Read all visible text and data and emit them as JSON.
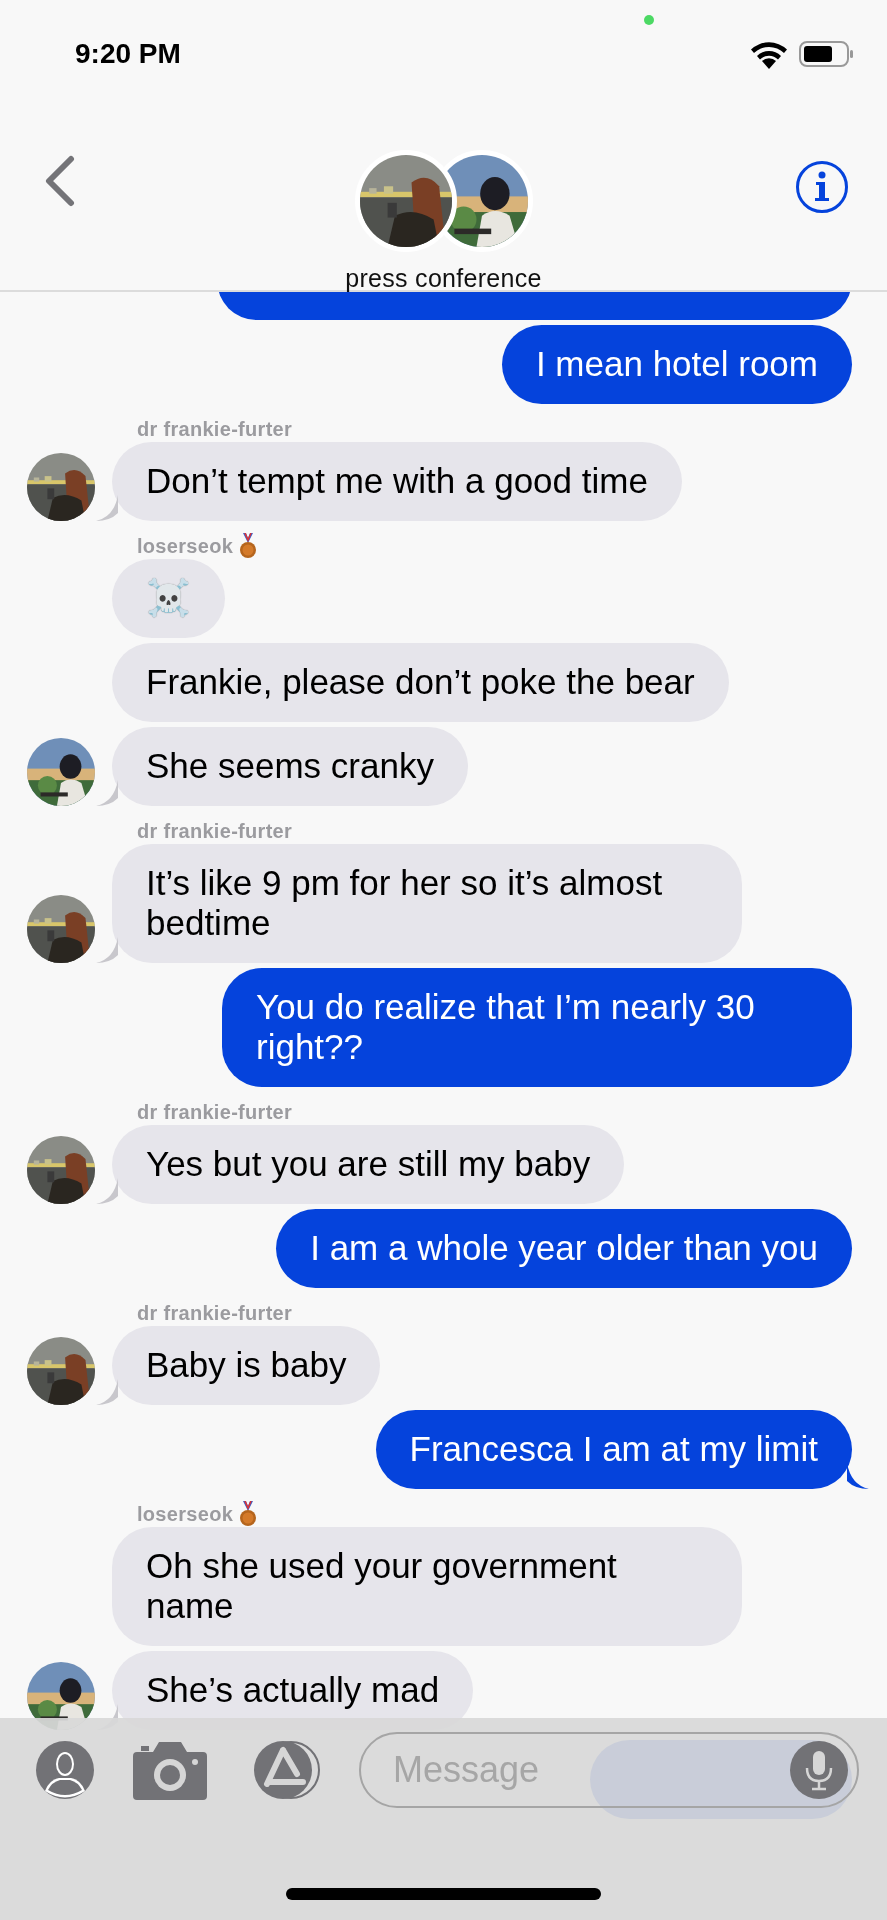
{
  "status_bar": {
    "time": "9:20 PM"
  },
  "header": {
    "title": "press conference"
  },
  "messages": [
    {
      "kind": "outgoing"
    },
    {
      "kind": "outgoing",
      "text": "I mean hotel room",
      "tail": false
    },
    {
      "kind": "sender",
      "name": "dr frankie-furter",
      "medal": false
    },
    {
      "kind": "incoming",
      "text": "Don’t tempt me with a good time",
      "avatar": true
    },
    {
      "kind": "sender",
      "name": "loserseok",
      "medal": true
    },
    {
      "kind": "incoming",
      "text": "☠️",
      "avatar": false
    },
    {
      "kind": "incoming",
      "text": "Frankie, please don’t poke the bear",
      "avatar": false
    },
    {
      "kind": "incoming",
      "text": "She seems cranky",
      "avatar": true
    },
    {
      "kind": "sender",
      "name": "dr frankie-furter",
      "medal": false
    },
    {
      "kind": "incoming",
      "text": "It’s like 9 pm for her so it’s almost bedtime",
      "avatar": true
    },
    {
      "kind": "outgoing",
      "text": "You do realize that I’m nearly 30 right??",
      "tail": false
    },
    {
      "kind": "sender",
      "name": "dr frankie-furter",
      "medal": false
    },
    {
      "kind": "incoming",
      "text": "Yes but you are still my baby",
      "avatar": true
    },
    {
      "kind": "outgoing",
      "text": "I am a whole year older than you",
      "tail": false
    },
    {
      "kind": "sender",
      "name": "dr frankie-furter",
      "medal": false
    },
    {
      "kind": "incoming",
      "text": "Baby is baby",
      "avatar": true
    },
    {
      "kind": "outgoing",
      "text": "Francesca I am at my limit",
      "tail": true
    },
    {
      "kind": "sender",
      "name": "loserseok",
      "medal": true
    },
    {
      "kind": "incoming",
      "text": "Oh she used your government name",
      "avatar": false
    },
    {
      "kind": "incoming",
      "text": "She’s actually mad",
      "avatar": true
    },
    {
      "kind": "outgoing"
    }
  ],
  "composer": {
    "placeholder": "Message"
  }
}
